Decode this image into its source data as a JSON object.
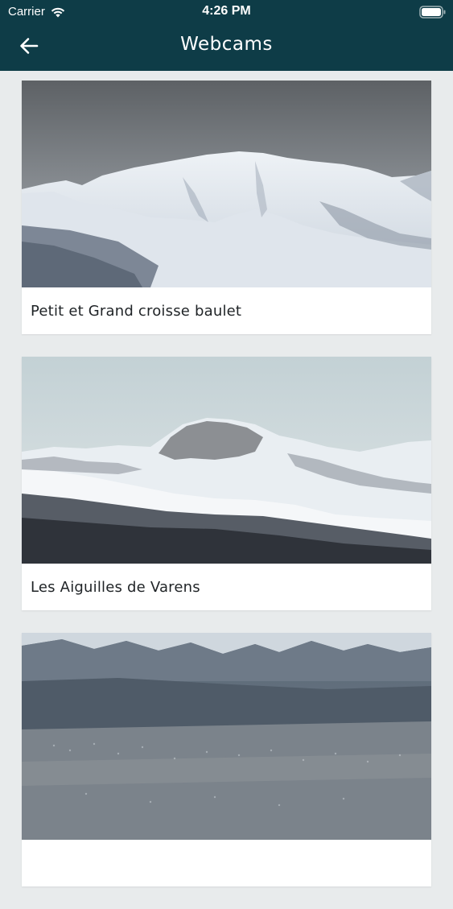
{
  "status_bar": {
    "carrier": "Carrier",
    "time": "4:26 PM"
  },
  "header": {
    "title": "Webcams",
    "back_icon": "arrow-left-icon",
    "background": "#0e3c47"
  },
  "webcams": [
    {
      "title": "Petit et Grand croisse baulet"
    },
    {
      "title": "Les Aiguilles de Varens"
    },
    {
      "title": ""
    }
  ]
}
